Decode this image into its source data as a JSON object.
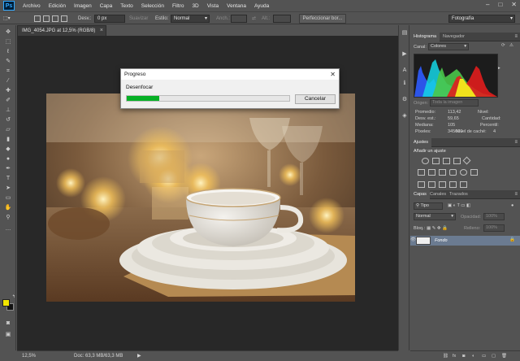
{
  "app": {
    "logo_text": "Ps"
  },
  "menu": [
    "Archivo",
    "Edición",
    "Imagen",
    "Capa",
    "Texto",
    "Selección",
    "Filtro",
    "3D",
    "Vista",
    "Ventana",
    "Ayuda"
  ],
  "window_controls": {
    "minimize": "‒",
    "maximize": "□",
    "close": "✕"
  },
  "options_bar": {
    "desvan_label": "Desv.:",
    "desvan_value": "0 px",
    "suavizar_label": "Suavizar",
    "estilo_label": "Estilo:",
    "estilo_value": "Normal",
    "anch_label": "Anch.:",
    "alt_label": "Alt.:",
    "refine_button": "Perfeccionar bor...",
    "workspace_value": "Fotografía"
  },
  "document": {
    "tab_title": "IMG_4054.JPG at 12,5% (RGB/8)",
    "tab_close": "×",
    "zoom": "12,5%",
    "doc_info": "Doc: 63,3 MB/63,3 MB"
  },
  "dialog": {
    "title": "Progreso",
    "close": "✕",
    "label": "Desenfocar",
    "progress": 0.2,
    "progress_color": "#06b025",
    "cancel_label": "Cancelar"
  },
  "histogram_panel": {
    "tabs": [
      "Histograma",
      "Navegador"
    ],
    "canal_label": "Canal:",
    "canal_value": "Colores",
    "origen_label": "Origen:",
    "origen_value": "Toda la imagen",
    "stats_left": [
      {
        "k": "Promedio:",
        "v": "113,42"
      },
      {
        "k": "Desv. est.:",
        "v": "59,65"
      },
      {
        "k": "Mediana:",
        "v": "105"
      },
      {
        "k": "Píxeles:",
        "v": "345600"
      }
    ],
    "stats_right": [
      {
        "k": "Nivel:",
        "v": ""
      },
      {
        "k": "Cantidad:",
        "v": ""
      },
      {
        "k": "Percentil:",
        "v": ""
      },
      {
        "k": "Nivel de caché:",
        "v": "4"
      }
    ]
  },
  "ajustes_panel": {
    "tab": "Ajustes",
    "heading": "Añadir un ajuste"
  },
  "capas_panel": {
    "tabs": [
      "Capas",
      "Canales",
      "Trazados"
    ],
    "kind_value": "Tipo",
    "mode_value": "Normal",
    "opacity_label": "Opacidad:",
    "opacity_value": "100%",
    "lock_label": "Bloq.:",
    "fill_label": "Relleno:",
    "fill_value": "100%",
    "layer_name": "Fondo",
    "layer_highlight": "#6b7b91"
  },
  "colors": {
    "fg": "#f2e600",
    "bg": "#111111"
  }
}
